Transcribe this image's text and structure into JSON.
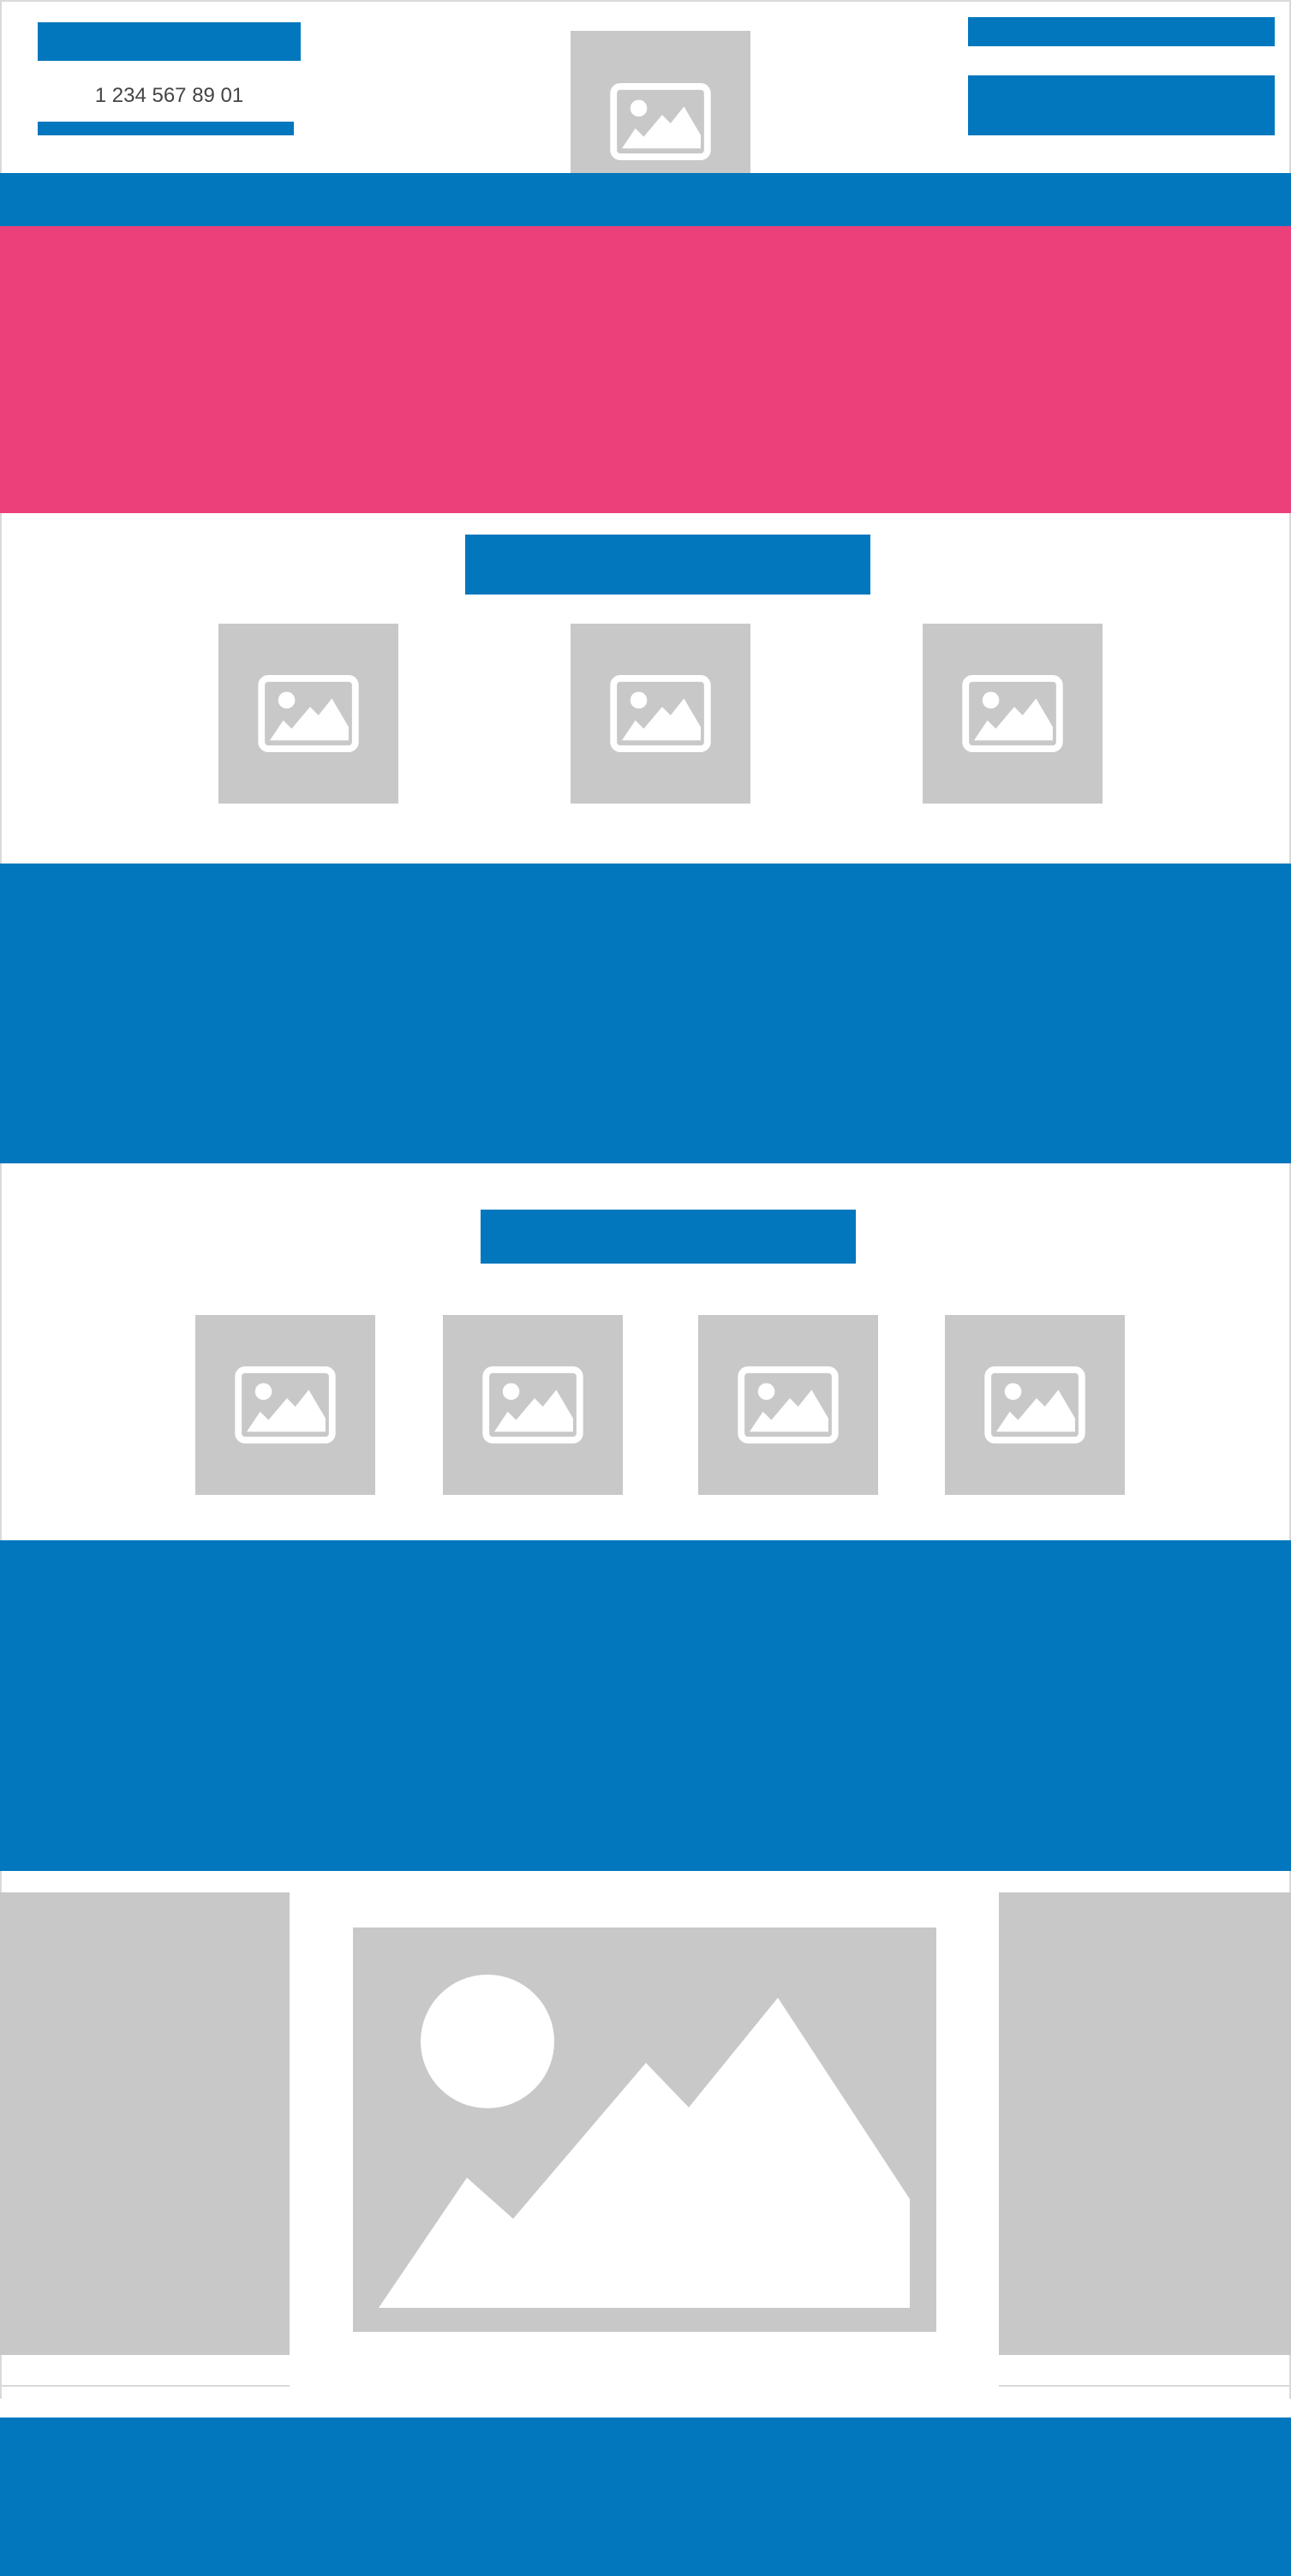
{
  "header": {
    "phone": "1 234 567 89 01"
  },
  "colors": {
    "primary": "#0277bd",
    "accent": "#ec407a",
    "placeholder": "#c8c8c8"
  },
  "icons": {
    "placeholder": "image-icon"
  }
}
